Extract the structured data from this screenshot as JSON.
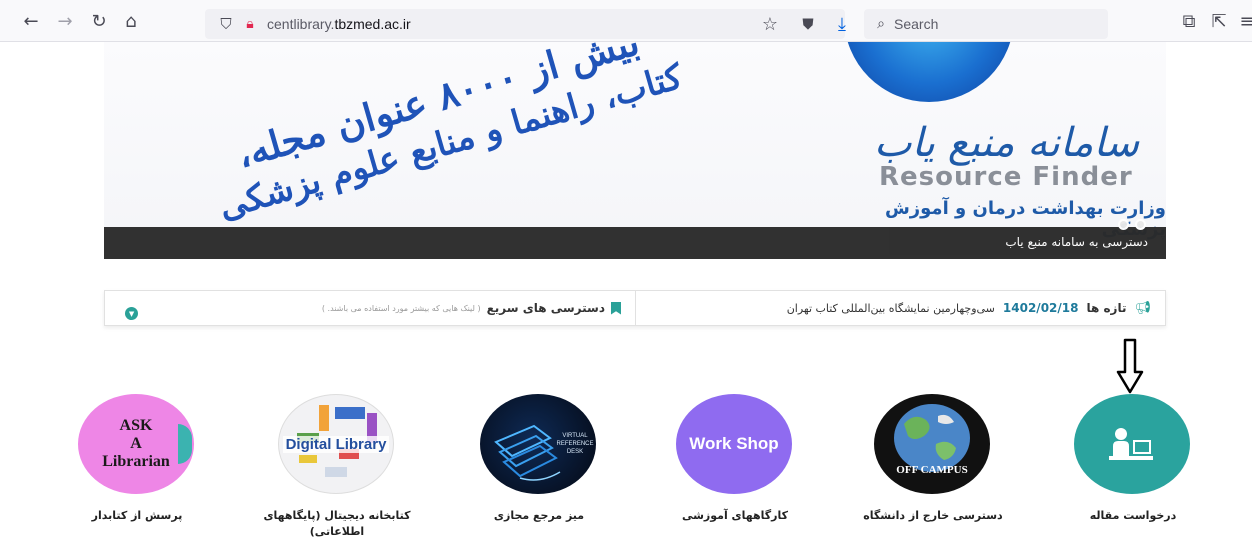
{
  "browser": {
    "url_prefix": "centlibrary.",
    "url_domain": "tbzmed.ac.ir",
    "search_placeholder": "Search",
    "icons": [
      "back-icon",
      "forward-icon",
      "reload-icon",
      "home-icon",
      "shield-icon",
      "lock-icon",
      "star-icon",
      "pocket-icon",
      "download-icon",
      "search-icon",
      "extensions-icon",
      "share-icon",
      "menu-icon"
    ]
  },
  "banner": {
    "slogan_line1": "بیش از ۸۰۰۰ عنوان مجله،",
    "slogan_line2": "کتاب، راهنما و منابع علوم پزشکی",
    "brand_fa": "سامانه منبع یاب",
    "brand_en": "Resource Finder",
    "ministry": "وزارت بهداشت درمان و آموزش پزشکی",
    "caption": "دسترسی به سامانه منبع یاب"
  },
  "news": {
    "title": "تازه ها",
    "date": "1402/02/18",
    "headline": "سی‌وچهارمین نمایشگاه بین‌المللی کتاب تهران",
    "quick_title": "دسترسی های سریع",
    "quick_note": "( لینک هایی که بیشتر مورد استفاده می باشند. )"
  },
  "services": [
    {
      "label": "درخواست مقاله",
      "color": "#2aa39e"
    },
    {
      "label": "دسترسی خارج از دانشگاه",
      "badge": "OFF CAMPUS"
    },
    {
      "label": "کارگاههای آموزشی",
      "badge": "Work Shop",
      "color": "#8f6bf0"
    },
    {
      "label": "میز مرجع مجازی",
      "badge_lines": [
        "VIRTUAL",
        "REFERENCE",
        "DESK"
      ]
    },
    {
      "label": "کتابخانه دیجیتال (پایگاههای اطلاعاتی)",
      "badge": "Digital Library"
    },
    {
      "label": "پرسش از کتابدار",
      "badge_lines": [
        "ASK",
        "A",
        "Librarian"
      ],
      "color": "#ee86e6"
    }
  ]
}
